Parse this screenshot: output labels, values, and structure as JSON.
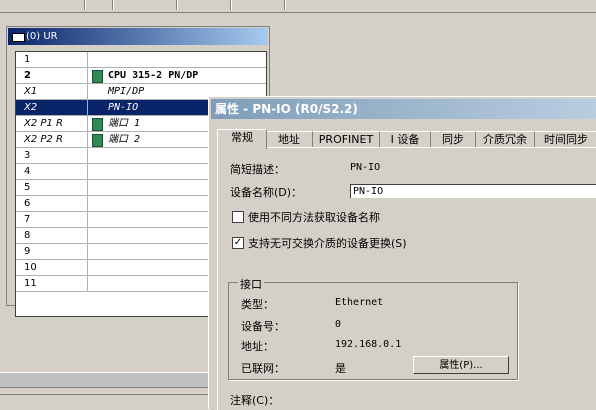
{
  "rack": {
    "title": "(0) UR",
    "rows": [
      {
        "slot": "1",
        "module": "",
        "style": "",
        "icon": false
      },
      {
        "slot": "2",
        "module": "CPU 315-2 PN/DP",
        "style": "bold",
        "icon": true
      },
      {
        "slot": "X1",
        "module": "MPI/DP",
        "style": "ital",
        "icon": false
      },
      {
        "slot": "X2",
        "module": "PN-IO",
        "style": "ital",
        "icon": false,
        "selected": true
      },
      {
        "slot": "X2 P1 R",
        "module": "端口 1",
        "style": "ital",
        "icon": true
      },
      {
        "slot": "X2 P2 R",
        "module": "端口 2",
        "style": "ital",
        "icon": true
      },
      {
        "slot": "3",
        "module": "",
        "style": "",
        "icon": false
      },
      {
        "slot": "4",
        "module": "",
        "style": "",
        "icon": false
      },
      {
        "slot": "5",
        "module": "",
        "style": "",
        "icon": false
      },
      {
        "slot": "6",
        "module": "",
        "style": "",
        "icon": false
      },
      {
        "slot": "7",
        "module": "",
        "style": "",
        "icon": false
      },
      {
        "slot": "8",
        "module": "",
        "style": "",
        "icon": false
      },
      {
        "slot": "9",
        "module": "",
        "style": "",
        "icon": false
      },
      {
        "slot": "10",
        "module": "",
        "style": "",
        "icon": false
      },
      {
        "slot": "11",
        "module": "",
        "style": "",
        "icon": false
      }
    ]
  },
  "dialog": {
    "title": "属性 - PN-IO (R0/S2.2)",
    "tabs": [
      "常规",
      "地址",
      "PROFINET",
      "I 设备",
      "同步",
      "介质冗余",
      "时间同步"
    ],
    "short_desc_label": "简短描述：",
    "short_desc_value": "PN-IO",
    "device_name_label": "设备名称(D)：",
    "device_name_value": "PN-IO",
    "checkbox1_label": "使用不同方法获取设备名称",
    "checkbox1_checked": false,
    "checkbox2_label": "支持无可交换介质的设备更换(S)",
    "checkbox2_checked": true,
    "interface": {
      "group_title": "接口",
      "type_label": "类型：",
      "type_value": "Ethernet",
      "device_no_label": "设备号：",
      "device_no_value": "0",
      "address_label": "地址：",
      "address_value": "192.168.0.1",
      "networked_label": "已联网：",
      "networked_value": "是",
      "properties_button": "属性(P)..."
    },
    "comment_label": "注释(C)："
  },
  "colors": {
    "rack_title": "#0a246a",
    "dialog_title": "#7f9db9",
    "selection": "#0a246a",
    "module_icon": "#2e8b57"
  }
}
